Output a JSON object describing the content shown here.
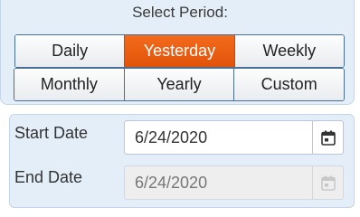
{
  "period": {
    "title": "Select Period:",
    "row1": [
      {
        "label": "Daily",
        "active": false
      },
      {
        "label": "Yesterday",
        "active": true
      },
      {
        "label": "Weekly",
        "active": false
      }
    ],
    "row2": [
      {
        "label": "Monthly",
        "active": false
      },
      {
        "label": "Yearly",
        "active": false
      },
      {
        "label": "Custom",
        "active": false
      }
    ]
  },
  "range": {
    "start_label": "Start Date",
    "start_value": "6/24/2020",
    "end_label": "End Date",
    "end_value": "6/24/2020",
    "end_disabled": true
  },
  "colors": {
    "accent": "#ef5f13",
    "panel": "#e3eef8",
    "border": "#4a6f96"
  },
  "icons": {
    "calendar": "calendar-icon"
  }
}
